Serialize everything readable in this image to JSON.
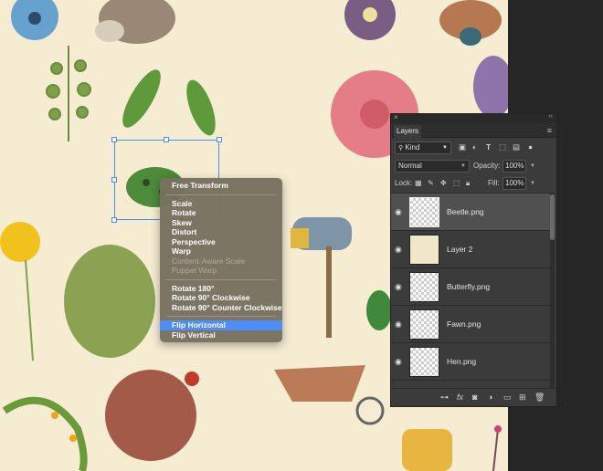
{
  "context_menu": {
    "items": [
      {
        "label": "Free Transform",
        "disabled": false,
        "highlighted": false
      },
      {
        "label": "Scale",
        "disabled": false,
        "highlighted": false
      },
      {
        "label": "Rotate",
        "disabled": false,
        "highlighted": false
      },
      {
        "label": "Skew",
        "disabled": false,
        "highlighted": false
      },
      {
        "label": "Distort",
        "disabled": false,
        "highlighted": false
      },
      {
        "label": "Perspective",
        "disabled": false,
        "highlighted": false
      },
      {
        "label": "Warp",
        "disabled": false,
        "highlighted": false
      },
      {
        "label": "Content-Aware Scale",
        "disabled": true,
        "highlighted": false
      },
      {
        "label": "Puppet Warp",
        "disabled": true,
        "highlighted": false
      },
      {
        "label": "Rotate 180°",
        "disabled": false,
        "highlighted": false
      },
      {
        "label": "Rotate 90° Clockwise",
        "disabled": false,
        "highlighted": false
      },
      {
        "label": "Rotate 90° Counter Clockwise",
        "disabled": false,
        "highlighted": false
      },
      {
        "label": "Flip Horizontal",
        "disabled": false,
        "highlighted": true
      },
      {
        "label": "Flip Vertical",
        "disabled": false,
        "highlighted": false
      }
    ]
  },
  "layers_panel": {
    "tab_label": "Layers",
    "filter_kind": "Kind",
    "blend_mode": "Normal",
    "opacity_label": "Opacity:",
    "opacity_value": "100%",
    "lock_label": "Lock:",
    "fill_label": "Fill:",
    "fill_value": "100%",
    "layers": [
      {
        "name": "Beetle.png",
        "selected": true
      },
      {
        "name": "Layer 2",
        "selected": false
      },
      {
        "name": "Butterfly.png",
        "selected": false
      },
      {
        "name": "Fawn.png",
        "selected": false
      },
      {
        "name": "Hen.png",
        "selected": false
      }
    ]
  },
  "colors": {
    "canvas_bg": "#f5ecd2",
    "menu_bg": "#797160",
    "menu_highlight": "#4e8cf7",
    "panel_bg": "#3b3b3b",
    "selection_box": "#4a8ff0"
  }
}
